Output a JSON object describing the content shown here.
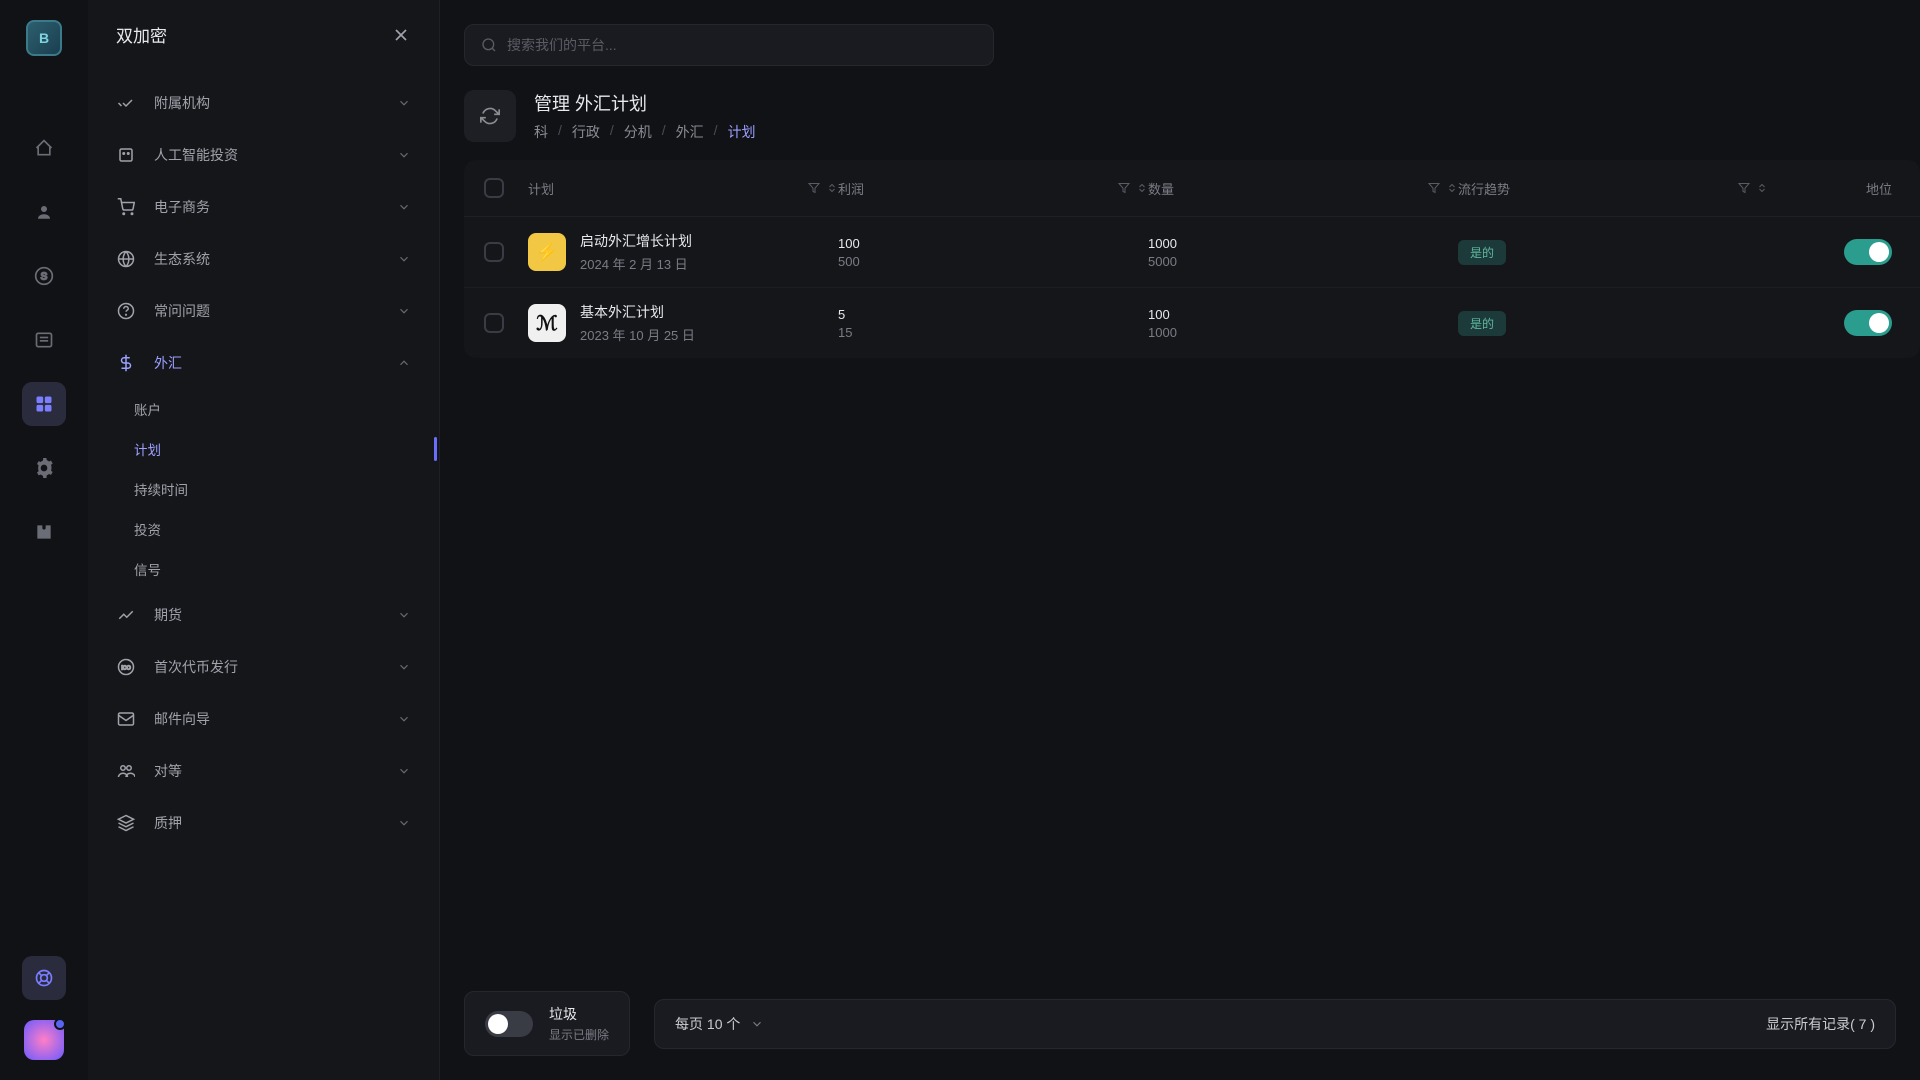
{
  "app": {
    "logo": "B",
    "title": "双加密"
  },
  "search": {
    "placeholder": "搜索我们的平台..."
  },
  "sidebar": {
    "items": [
      {
        "label": "附属机构",
        "icon": "handshake"
      },
      {
        "label": "人工智能投资",
        "icon": "ai"
      },
      {
        "label": "电子商务",
        "icon": "cart"
      },
      {
        "label": "生态系统",
        "icon": "globe"
      },
      {
        "label": "常问问题",
        "icon": "question"
      },
      {
        "label": "外汇",
        "icon": "dollar",
        "expanded": true
      },
      {
        "label": "期货",
        "icon": "chart"
      },
      {
        "label": "首次代币发行",
        "icon": "ico"
      },
      {
        "label": "邮件向导",
        "icon": "mail"
      },
      {
        "label": "对等",
        "icon": "people"
      },
      {
        "label": "质押",
        "icon": "layers"
      }
    ],
    "forex_sub": [
      {
        "label": "账户"
      },
      {
        "label": "计划",
        "active": true
      },
      {
        "label": "持续时间"
      },
      {
        "label": "投资"
      },
      {
        "label": "信号"
      }
    ]
  },
  "page": {
    "title": "管理 外汇计划",
    "breadcrumb": [
      "科",
      "行政",
      "分机",
      "外汇",
      "计划"
    ]
  },
  "table": {
    "headers": {
      "plan": "计划",
      "profit": "利润",
      "qty": "数量",
      "trend": "流行趋势",
      "status": "地位"
    },
    "rows": [
      {
        "thumb": "yellow",
        "name": "启动外汇增长计划",
        "date": "2024 年 2 月 13 日",
        "profit1": "100",
        "profit2": "500",
        "qty1": "1000",
        "qty2": "5000",
        "trend": "是的",
        "status": true
      },
      {
        "thumb": "white",
        "name": "基本外汇计划",
        "date": "2023 年 10 月 25 日",
        "profit1": "5",
        "profit2": "15",
        "qty1": "100",
        "qty2": "1000",
        "trend": "是的",
        "status": true
      }
    ]
  },
  "footer": {
    "trash_title": "垃圾",
    "trash_sub": "显示已删除",
    "perpage": "每页 10 个",
    "records": "显示所有记录( 7 )"
  }
}
